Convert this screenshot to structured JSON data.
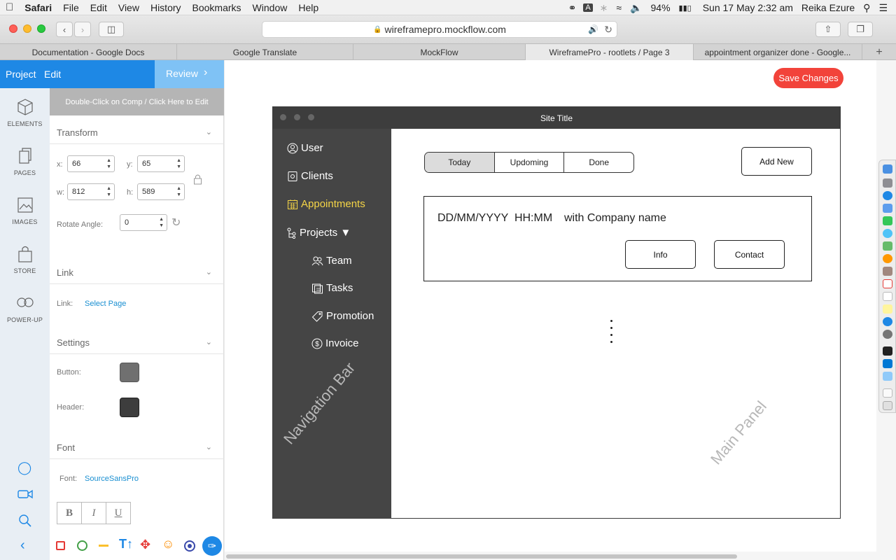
{
  "menubar": {
    "app": "Safari",
    "items": [
      "File",
      "Edit",
      "View",
      "History",
      "Bookmarks",
      "Window",
      "Help"
    ],
    "battery": "94%",
    "datetime": "Sun 17 May  2:32 am",
    "user": "Reika Ezure"
  },
  "browser": {
    "url": "wireframepro.mockflow.com",
    "tabs": [
      {
        "label": "Documentation - Google Docs"
      },
      {
        "label": "Google Translate"
      },
      {
        "label": "MockFlow"
      },
      {
        "label": "WireframePro - rootlets / Page 3"
      },
      {
        "label": "appointment organizer done - Google..."
      }
    ]
  },
  "editor": {
    "project_label": "Project",
    "edit_label": "Edit",
    "review_label": "Review",
    "hint": "Double-Click on Comp / Click Here to Edit",
    "rail": [
      "ELEMENTS",
      "PAGES",
      "IMAGES",
      "STORE",
      "POWER-UP"
    ],
    "transform": {
      "title": "Transform",
      "x_label": "x:",
      "x": "66",
      "y_label": "y:",
      "y": "65",
      "w_label": "w:",
      "w": "812",
      "h_label": "h:",
      "h": "589",
      "rotate_label": "Rotate Angle:",
      "rotate": "0"
    },
    "link": {
      "title": "Link",
      "label": "Link:",
      "value": "Select Page"
    },
    "settings": {
      "title": "Settings",
      "button_label": "Button:",
      "header_label": "Header:",
      "button_color": "#707070",
      "header_color": "#3d3d3d"
    },
    "font": {
      "title": "Font",
      "label": "Font:",
      "value": "SourceSansPro",
      "bold": "B",
      "italic": "I",
      "underline": "U"
    },
    "save_label": "Save Changes",
    "colors": {
      "accent": "#2196f3",
      "save": "#f2433a",
      "link": "#1a8fd1"
    }
  },
  "wireframe": {
    "site_title": "Site Title",
    "nav": [
      {
        "label": "User",
        "icon": "user-icon"
      },
      {
        "label": "Clients",
        "icon": "clients-icon"
      },
      {
        "label": "Appointments",
        "icon": "calendar-icon",
        "active": true
      },
      {
        "label": "Projects ▼",
        "icon": "tree-icon"
      },
      {
        "label": "Team",
        "icon": "team-icon"
      },
      {
        "label": "Tasks",
        "icon": "tasks-icon"
      },
      {
        "label": "Promotion",
        "icon": "tag-icon"
      },
      {
        "label": "Invoice",
        "icon": "dollar-icon"
      }
    ],
    "tabs": [
      "Today",
      "Updoming",
      "Done"
    ],
    "add_new": "Add New",
    "card": {
      "datetime": "DD/MM/YYYY  HH:MM",
      "company": "with Company name",
      "info": "Info",
      "contact": "Contact"
    },
    "nav_watermark": "Navigation Bar",
    "main_watermark": "Main Panel",
    "active_color": "#f5d547"
  }
}
